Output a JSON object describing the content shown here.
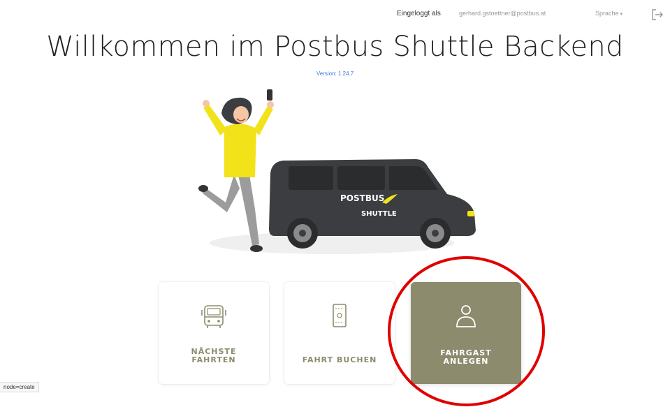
{
  "header": {
    "logged_in_label": "Eingeloggt als",
    "user_email": "gerhard.gstoettner@postbus.at",
    "language_label": "Sprache",
    "language_caret": "▾"
  },
  "main": {
    "title": "Willkommen im Postbus Shuttle Backend",
    "version": "Version: 1.24.7"
  },
  "illustration": {
    "van_brand_top": "POSTBUS",
    "van_brand_bottom": "SHUTTLE"
  },
  "cards": [
    {
      "line1": "NÄCHSTE",
      "line2": "FAHRTEN",
      "icon": "bus-icon"
    },
    {
      "line1": "FAHRT BUCHEN",
      "line2": "",
      "icon": "ticket-icon"
    },
    {
      "line1": "FAHRGAST",
      "line2": "ANLEGEN",
      "icon": "user-icon"
    }
  ],
  "status_bar": {
    "text": "node=create"
  },
  "colors": {
    "accent": "#8d8b6d",
    "version_link": "#3a7bd5",
    "highlight": "#e00000",
    "van": "#3b3d40",
    "shirt": "#f2e21a"
  }
}
